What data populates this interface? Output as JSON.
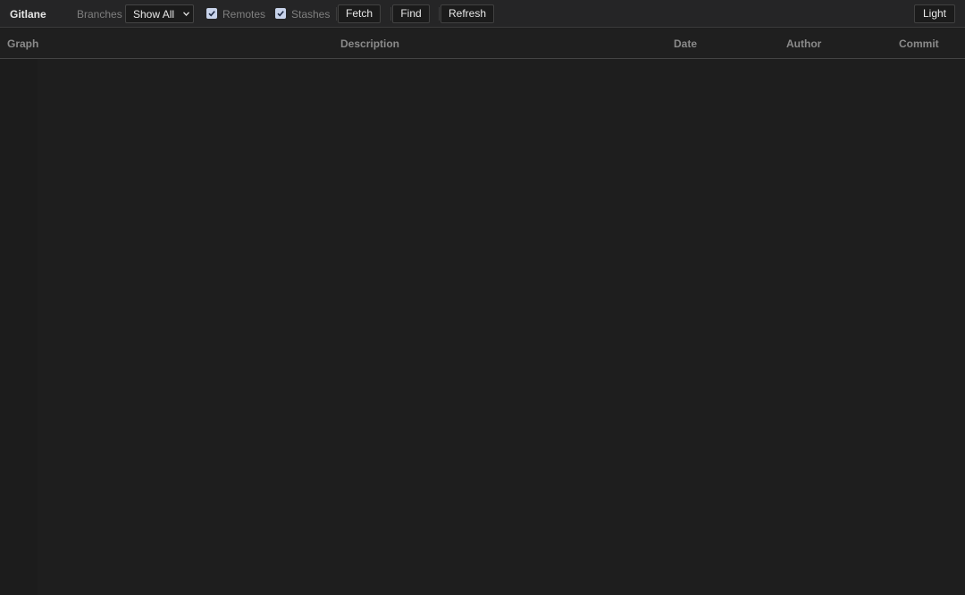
{
  "toolbar": {
    "app_title": "Gitlane",
    "branches_label": "Branches",
    "branch_select_value": "Show All",
    "remotes_label": "Remotes",
    "remotes_checked": true,
    "stashes_label": "Stashes",
    "stashes_checked": true,
    "fetch_label": "Fetch",
    "find_label": "Find",
    "refresh_label": "Refresh",
    "theme_label": "Light"
  },
  "columns": {
    "graph": "Graph",
    "description": "Description",
    "date": "Date",
    "author": "Author",
    "commit": "Commit"
  },
  "colors": {
    "background": "#1e1e1e",
    "toolbar": "#252526",
    "checkbox": "#c8d3ea",
    "text": "#e8e8e8",
    "muted": "#7f7f7f"
  },
  "icons": {
    "select_chevron": "chevron-down-icon",
    "checkmark": "checkmark-icon"
  }
}
